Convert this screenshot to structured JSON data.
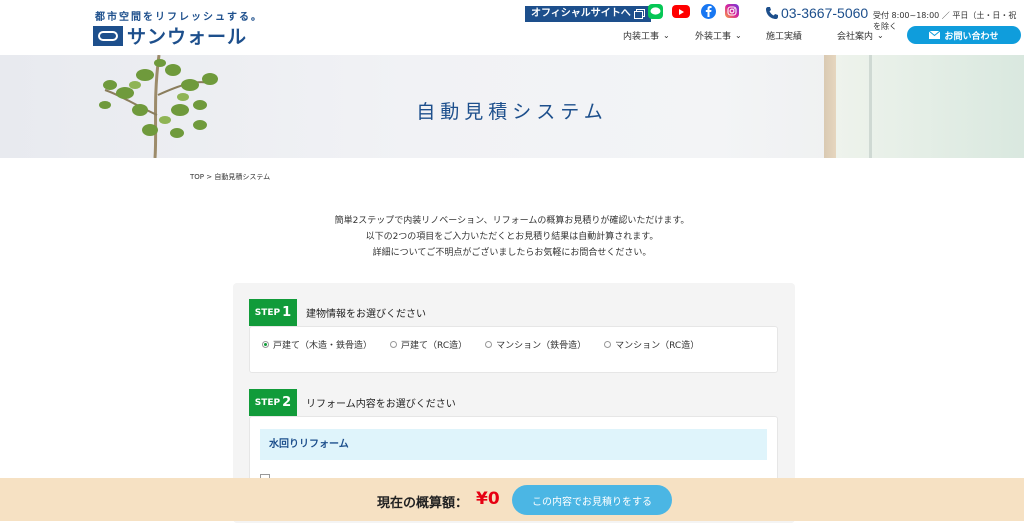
{
  "header": {
    "tagline": "都市空間をリフレッシュする。",
    "logo_text": "サンウォール",
    "official_site": "オフィシャルサイトへ",
    "phone": "03-3667-5060",
    "hours": "受付 8:00~18:00 ／ 平日（土・日・祝を除く",
    "nav": [
      {
        "label": "内装工事",
        "has_dropdown": true
      },
      {
        "label": "外装工事",
        "has_dropdown": true
      },
      {
        "label": "施工実績",
        "has_dropdown": false
      },
      {
        "label": "会社案内",
        "has_dropdown": true
      }
    ],
    "contact": "お問い合わせ"
  },
  "hero": {
    "title": "自動見積システム"
  },
  "breadcrumb": "TOP > 自動見積システム",
  "intro": [
    "簡単2ステップで内装リノベーション、リフォームの概算お見積りが確認いただけます。",
    "以下の2つの項目をご入力いただくとお見積り結果は自動計算されます。",
    "詳細についてご不明点がございましたらお気軽にお問合せください。"
  ],
  "step1": {
    "badge_text": "STEP",
    "badge_num": "1",
    "title": "建物情報をお選びください",
    "options": [
      {
        "label": "戸建て（木造・鉄骨造）",
        "selected": true
      },
      {
        "label": "戸建て（RC造）",
        "selected": false
      },
      {
        "label": "マンション（鉄骨造）",
        "selected": false
      },
      {
        "label": "マンション（RC造）",
        "selected": false
      }
    ]
  },
  "step2": {
    "badge_text": "STEP",
    "badge_num": "2",
    "title": "リフォーム内容をお選びください",
    "section": "水回りリフォーム"
  },
  "estimate": {
    "label": "現在の概算額：",
    "value": "¥0",
    "button": "この内容でお見積りをする"
  },
  "colors": {
    "brand_blue": "#1d4f8c",
    "step_green": "#119b3a",
    "accent_red": "#e60012",
    "button_blue": "#4bb6e4",
    "bar_beige": "#f6e1c3"
  }
}
